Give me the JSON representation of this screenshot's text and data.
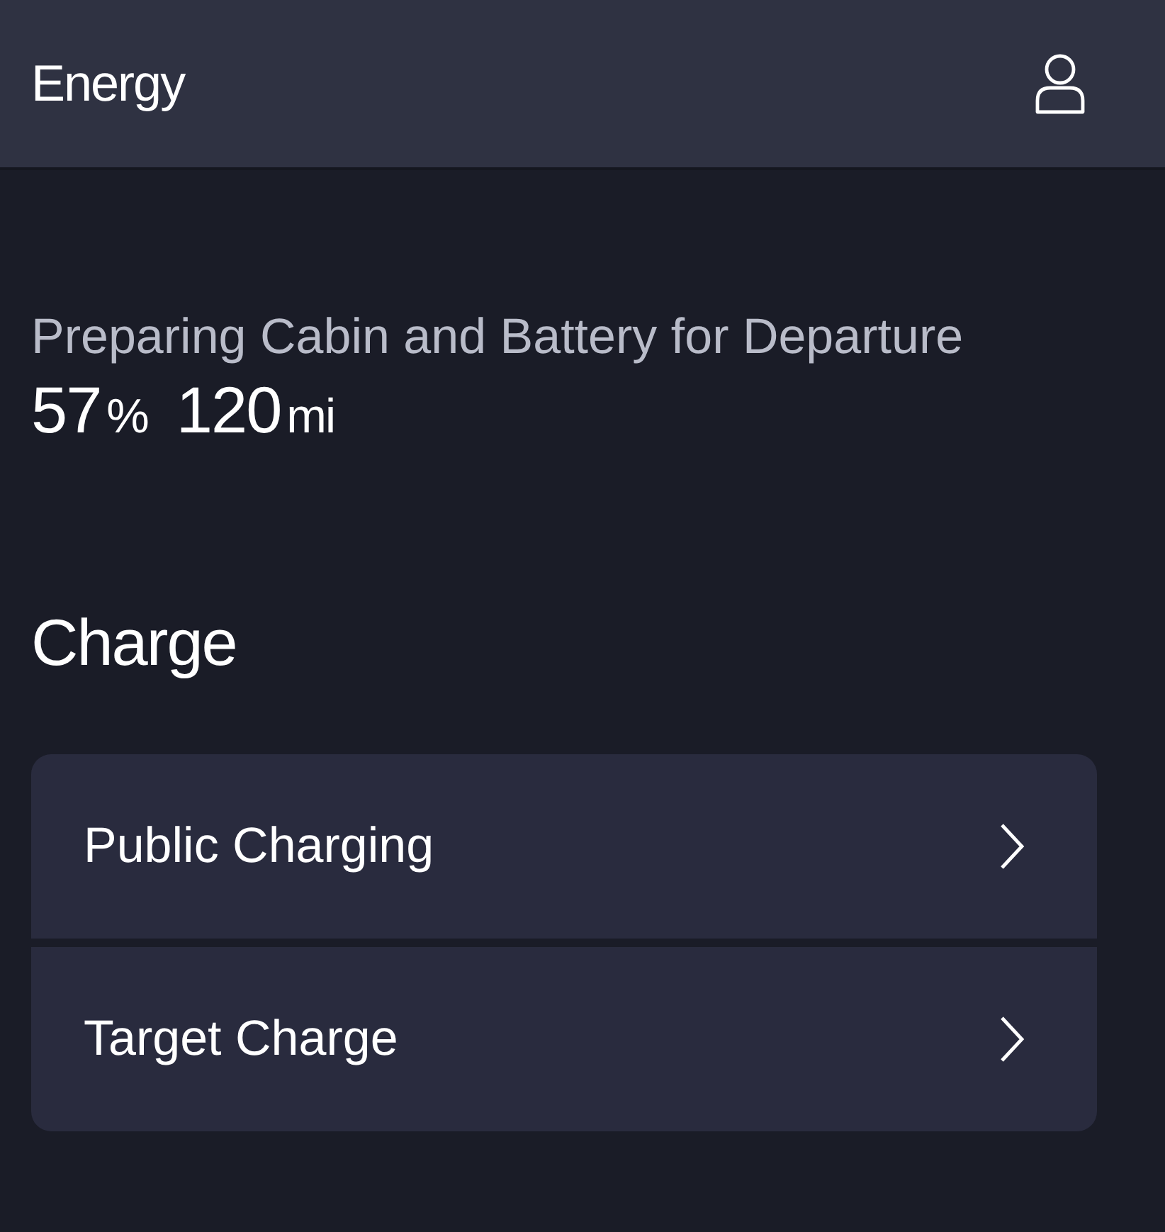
{
  "header": {
    "title": "Energy"
  },
  "status": {
    "message": "Preparing Cabin and Battery for Departure",
    "stats": [
      {
        "value": "57",
        "unit": "%"
      },
      {
        "value": "120",
        "unit": "mi"
      }
    ]
  },
  "section": {
    "title": "Charge",
    "items": [
      {
        "label": "Public Charging"
      },
      {
        "label": "Target Charge"
      }
    ]
  }
}
